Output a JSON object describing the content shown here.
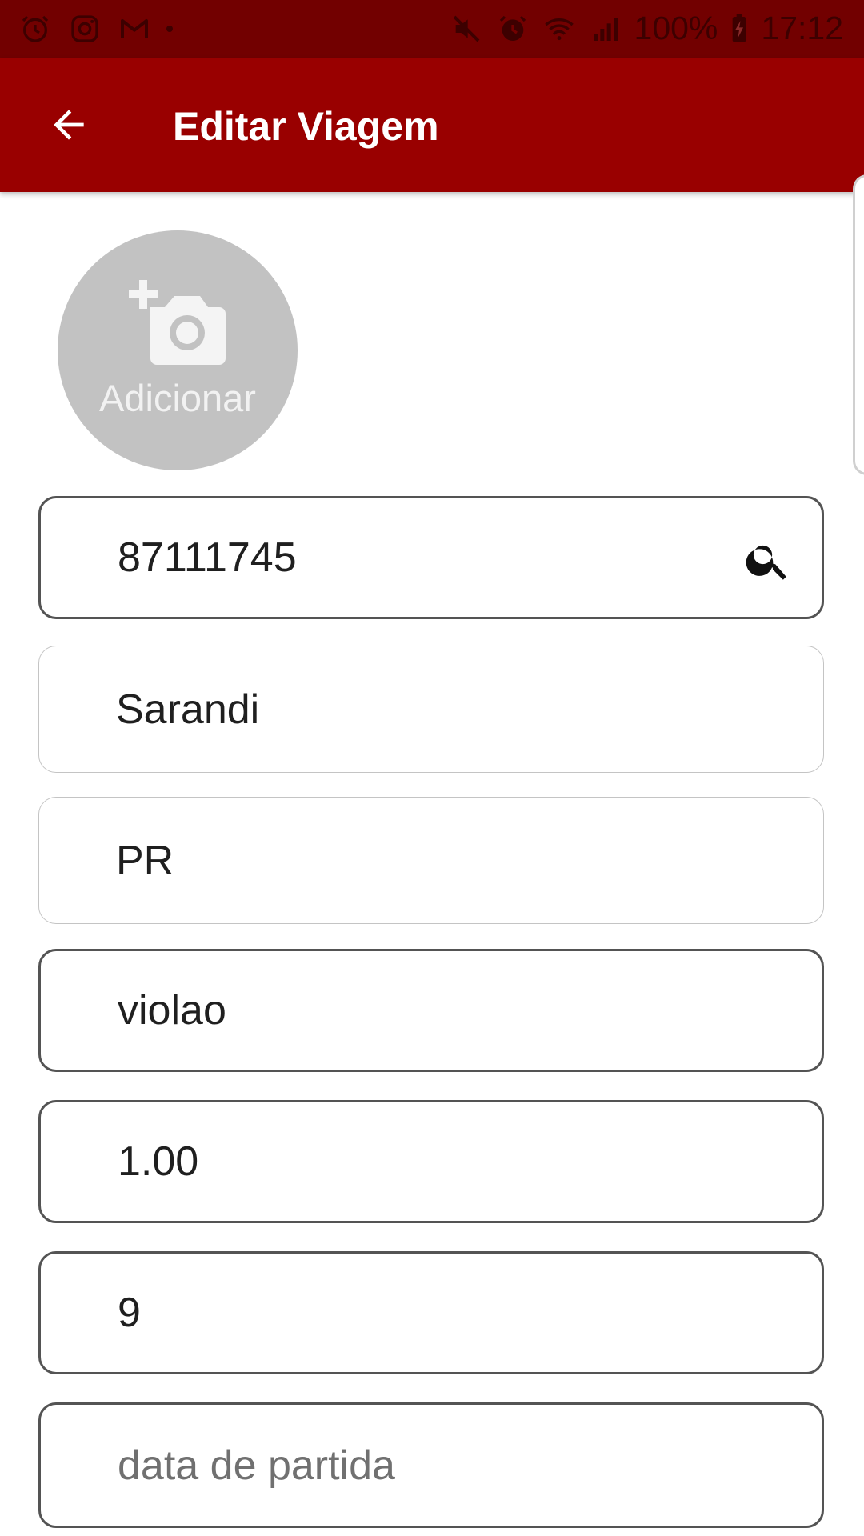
{
  "status_bar": {
    "battery": "100%",
    "time": "17:12",
    "left_icons": [
      "alarm-icon",
      "instagram-icon",
      "gmail-icon",
      "dot-icon"
    ],
    "right_icons": [
      "mute-icon",
      "alarm-icon",
      "wifi-icon",
      "signal-icon",
      "battery-charging-icon"
    ]
  },
  "app_bar": {
    "title": "Editar Viagem",
    "back_icon": "arrow-back-icon",
    "color": "#990000"
  },
  "photo": {
    "label": "Adicionar",
    "icon": "add-a-photo-icon"
  },
  "form": {
    "cep": "87111745",
    "cidade": "Sarandi",
    "estado": "PR",
    "descricao": "violao",
    "valor": "1.00",
    "quantidade": "9",
    "data_partida_placeholder": "data de partida"
  }
}
